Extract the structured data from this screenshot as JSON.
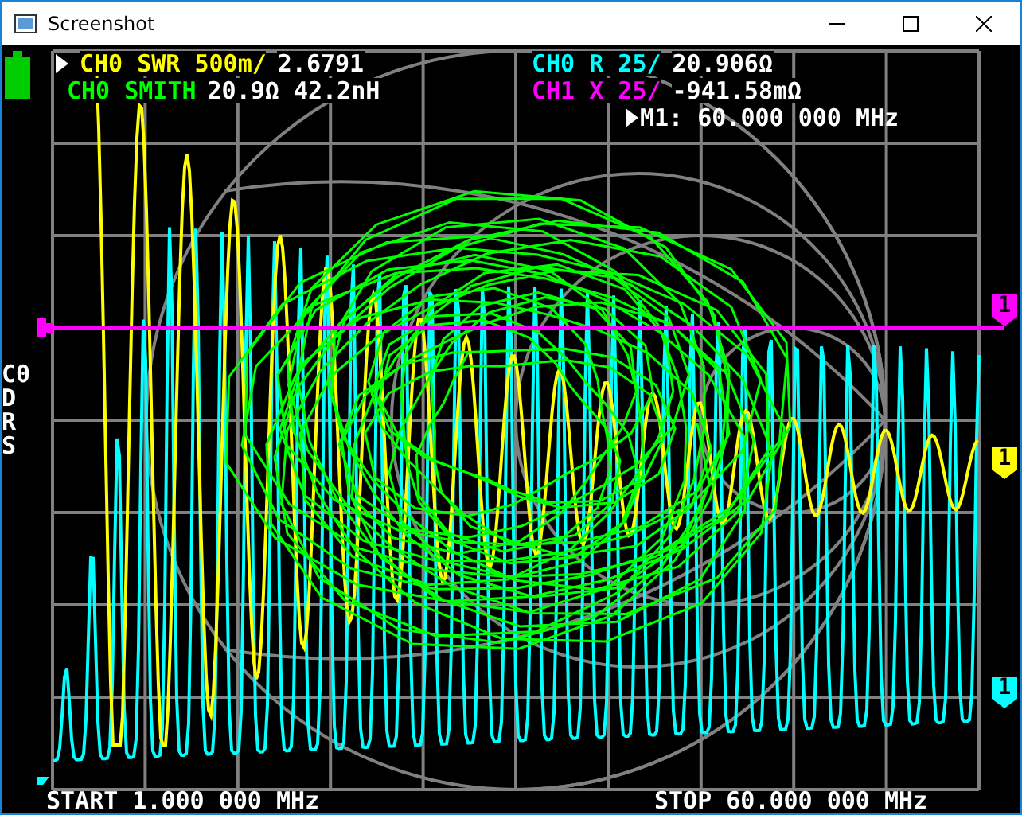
{
  "window": {
    "title": "Screenshot"
  },
  "traces": [
    {
      "label": "CH0 SWR 500m/",
      "reading": "2.6791",
      "color": "#ffff00",
      "selected": true
    },
    {
      "label": "CH0 SMITH",
      "reading": "20.9Ω 42.2nH",
      "color": "#00ff00",
      "selected": false
    },
    {
      "label": "CH0 R 25/",
      "reading": "20.906Ω",
      "color": "#00ffff",
      "selected": false
    },
    {
      "label": "CH1 X 25/",
      "reading": "-941.58mΩ",
      "color": "#ff00ff",
      "selected": false
    }
  ],
  "marker_readout": {
    "label": "M1: 60.000 000 MHz",
    "selected": true
  },
  "side_status": [
    "C0",
    "D",
    "R",
    "S"
  ],
  "marker_tags": [
    {
      "label": "1",
      "color": "#ff00ff"
    },
    {
      "label": "1",
      "color": "#ffff00"
    },
    {
      "label": "1",
      "color": "#00ffff"
    }
  ],
  "start": "START 1.000 000 MHz",
  "stop": "STOP 60.000 000 MHz"
}
